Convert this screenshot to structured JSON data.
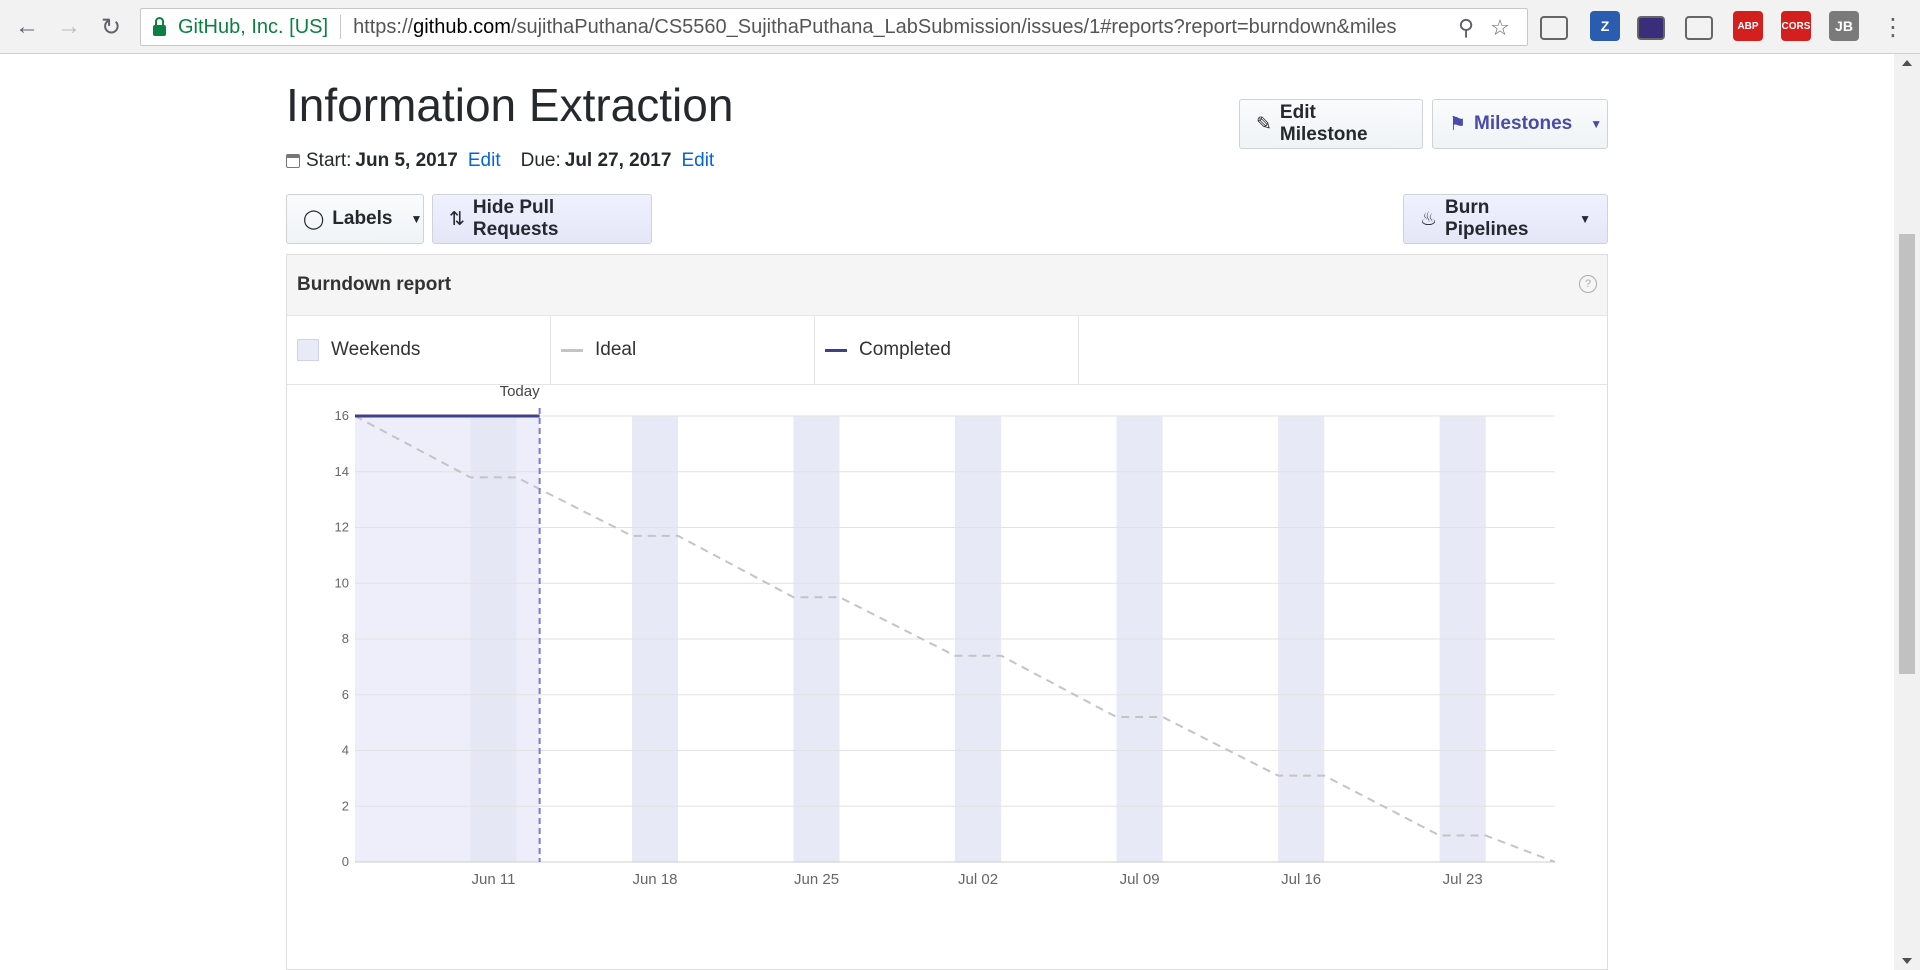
{
  "browser": {
    "org": "GitHub, Inc. [US]",
    "url_prefix": "https://",
    "url_host": "github.com",
    "url_path": "/sujithaPuthana/CS5560_SujithaPuthana_LabSubmission/issues/1#reports?report=burndown&miles",
    "extensions": [
      {
        "name": "cast-icon",
        "label": "",
        "color": "#f2f2f2"
      },
      {
        "name": "zotero-icon",
        "label": "Z",
        "color": "#2a5db0"
      },
      {
        "name": "extension-icon",
        "label": "",
        "color": "#3a2d7a"
      },
      {
        "name": "globe-icon",
        "label": "",
        "color": "#f2f2f2"
      },
      {
        "name": "adblock-icon",
        "label": "ABP",
        "color": "#d3201f"
      },
      {
        "name": "cors-icon",
        "label": "CORS",
        "color": "#d3201f"
      },
      {
        "name": "jb-icon",
        "label": "JB",
        "color": "#7a7a7a"
      }
    ]
  },
  "milestone": {
    "title": "Information Extraction",
    "start_label": "Start:",
    "start_date": "Jun 5, 2017",
    "due_label": "Due:",
    "due_date": "Jul 27, 2017",
    "edit_label": "Edit"
  },
  "toolbar": {
    "edit_milestone": "Edit Milestone",
    "milestones": "Milestones",
    "labels": "Labels",
    "hide_pull_requests": "Hide Pull Requests",
    "burn_pipelines": "Burn Pipelines"
  },
  "report": {
    "title": "Burndown report",
    "help": "?",
    "legend": [
      {
        "label": "Weekends",
        "kind": "box",
        "color": "#e9eaf7"
      },
      {
        "label": "Ideal",
        "kind": "line",
        "color": "#c4c4c4"
      },
      {
        "label": "Completed",
        "kind": "line",
        "color": "#3f3f8f"
      }
    ]
  },
  "chart_data": {
    "type": "line",
    "today_label": "Today",
    "x_ticks": [
      "Jun 11",
      "Jun 18",
      "Jun 25",
      "Jul 02",
      "Jul 09",
      "Jul 16",
      "Jul 23"
    ],
    "ylim": [
      0,
      16
    ],
    "y_ticks": [
      0,
      2,
      4,
      6,
      8,
      10,
      12,
      14,
      16
    ],
    "x_start": "2017-06-05",
    "x_end": "2017-07-27",
    "today": "2017-06-13",
    "weekends": [
      [
        "2017-06-10",
        "2017-06-12"
      ],
      [
        "2017-06-17",
        "2017-06-19"
      ],
      [
        "2017-06-24",
        "2017-06-26"
      ],
      [
        "2017-07-01",
        "2017-07-03"
      ],
      [
        "2017-07-08",
        "2017-07-10"
      ],
      [
        "2017-07-15",
        "2017-07-17"
      ],
      [
        "2017-07-22",
        "2017-07-24"
      ]
    ],
    "series": [
      {
        "name": "Ideal",
        "color": "#c4c4c4",
        "dashed": true,
        "points": [
          [
            "2017-06-05",
            16
          ],
          [
            "2017-06-10",
            13.8
          ],
          [
            "2017-06-12",
            13.8
          ],
          [
            "2017-06-17",
            11.7
          ],
          [
            "2017-06-19",
            11.7
          ],
          [
            "2017-06-24",
            9.5
          ],
          [
            "2017-06-26",
            9.5
          ],
          [
            "2017-07-01",
            7.4
          ],
          [
            "2017-07-03",
            7.4
          ],
          [
            "2017-07-08",
            5.2
          ],
          [
            "2017-07-10",
            5.2
          ],
          [
            "2017-07-15",
            3.1
          ],
          [
            "2017-07-17",
            3.1
          ],
          [
            "2017-07-22",
            0.95
          ],
          [
            "2017-07-24",
            0.95
          ],
          [
            "2017-07-27",
            0
          ]
        ]
      },
      {
        "name": "Completed",
        "color": "#3f3f8f",
        "dashed": false,
        "points": [
          [
            "2017-06-05",
            16
          ],
          [
            "2017-06-13",
            16
          ]
        ]
      }
    ],
    "grid": true
  }
}
